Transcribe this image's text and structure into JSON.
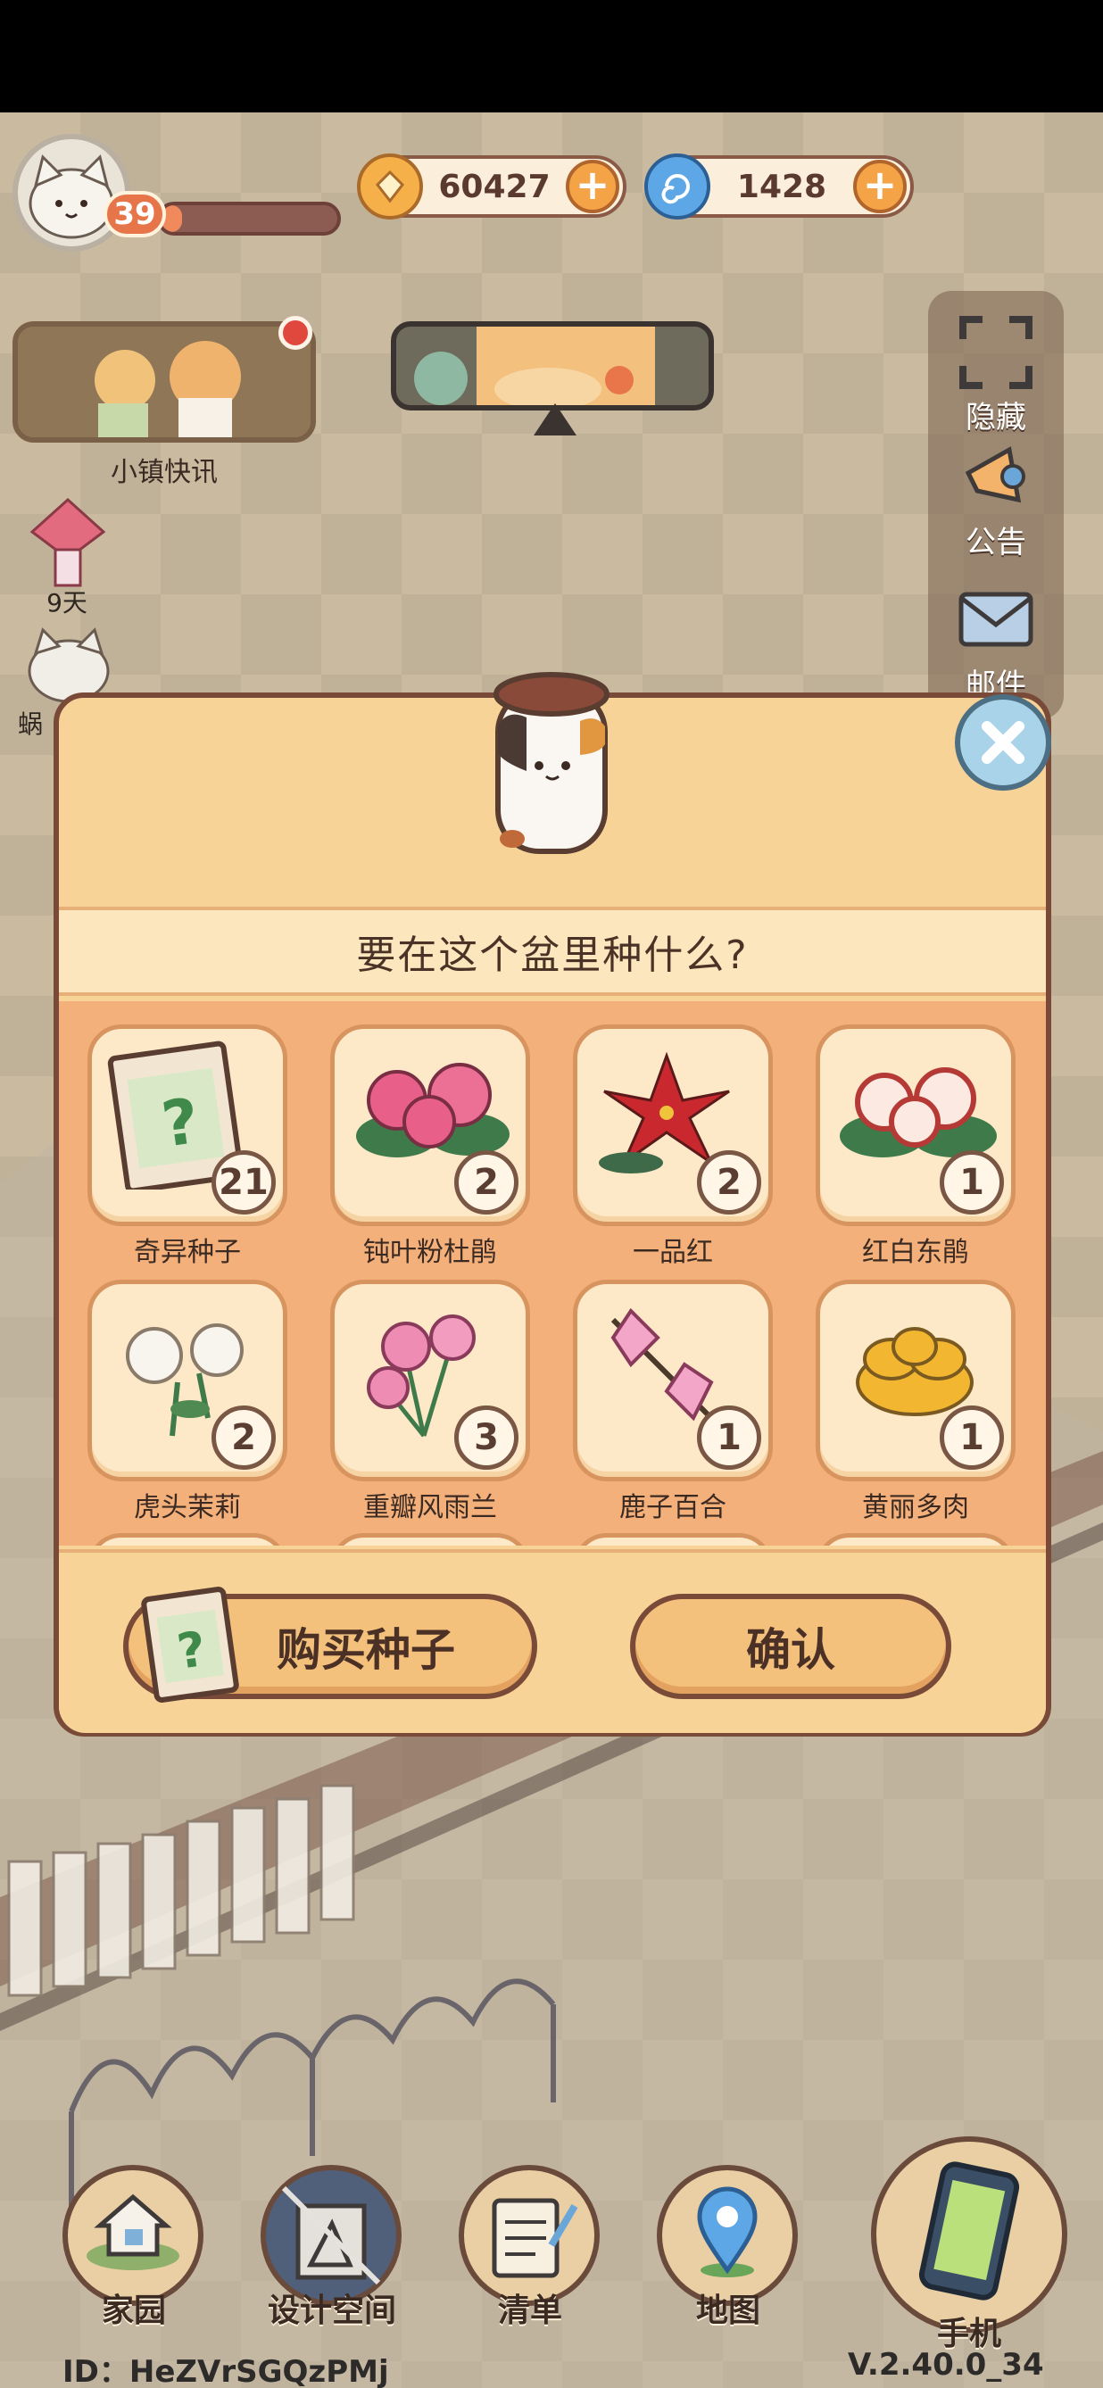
{
  "hud": {
    "level": "39",
    "xp_fraction": 0.12,
    "coins": "60427",
    "gems": "1428"
  },
  "left_panel": {
    "news_label": "小镇快讯",
    "event_days": "9天",
    "snail_label": "蜗"
  },
  "sidebar": {
    "hide_label": "隐藏",
    "notice_label": "公告",
    "mail_label": "邮件"
  },
  "modal": {
    "question": "要在这个盆里种什么?",
    "buy_label": "购买种子",
    "confirm_label": "确认",
    "items": [
      {
        "name": "奇异种子",
        "count": "21"
      },
      {
        "name": "钝叶粉杜鹃",
        "count": "2"
      },
      {
        "name": "一品红",
        "count": "2"
      },
      {
        "name": "红白东鹃",
        "count": "1"
      },
      {
        "name": "虎头茉莉",
        "count": "2"
      },
      {
        "name": "重瓣风雨兰",
        "count": "3"
      },
      {
        "name": "鹿子百合",
        "count": "1"
      },
      {
        "name": "黄丽多肉",
        "count": "1"
      }
    ]
  },
  "bottom_nav": {
    "home": "家园",
    "design": "设计空间",
    "list": "清单",
    "map": "地图",
    "phone": "手机"
  },
  "footer": {
    "id": "ID：HeZVrSGQzPMj",
    "version": "V.2.40.0_34"
  },
  "colors": {
    "panel": "#f7d398",
    "grid_bg": "#f4b07a",
    "card": "#fde8c8",
    "border": "#7a4a38"
  }
}
